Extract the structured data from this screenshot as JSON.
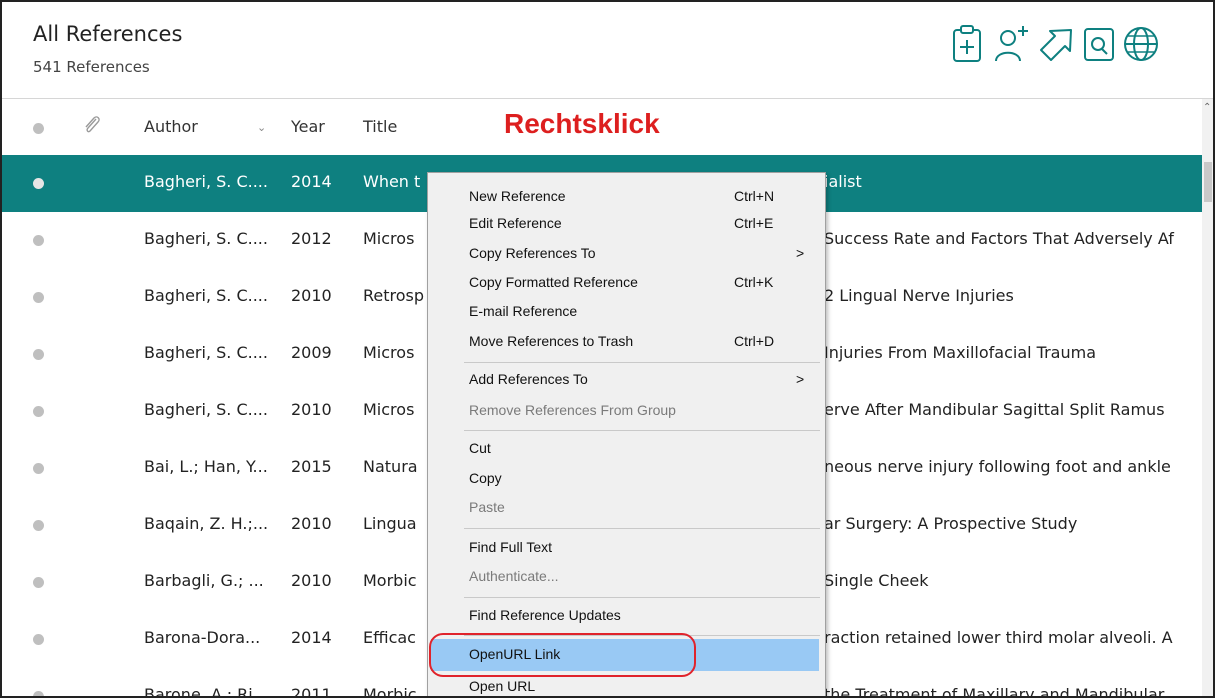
{
  "header": {
    "title": "All References",
    "count": "541 References",
    "toolbar_icons": [
      "new-reference-clipboard-icon",
      "add-user-icon",
      "open-external-arrow-icon",
      "find-text-icon",
      "online-globe-icon"
    ],
    "accent_color": "#0e8080"
  },
  "columns": {
    "author": "Author",
    "year": "Year",
    "title": "Title"
  },
  "annotation": "Rechtsklick",
  "rows": [
    {
      "author": "Bagheri, S. C....",
      "year": "2014",
      "title_start": "When t",
      "title_end": "ialist"
    },
    {
      "author": "Bagheri, S. C....",
      "year": "2012",
      "title_start": "Micros",
      "title_end": "Success Rate and Factors That Adversely Af"
    },
    {
      "author": "Bagheri, S. C....",
      "year": "2010",
      "title_start": "Retrosp",
      "title_end": "2 Lingual Nerve Injuries"
    },
    {
      "author": "Bagheri, S. C....",
      "year": "2009",
      "title_start": "Micros",
      "title_end": "Injuries From Maxillofacial Trauma"
    },
    {
      "author": "Bagheri, S. C....",
      "year": "2010",
      "title_start": "Micros",
      "title_end": "erve After Mandibular Sagittal Split Ramus"
    },
    {
      "author": "Bai, L.; Han, Y...",
      "year": "2015",
      "title_start": "Natura",
      "title_end": "neous nerve injury following foot and ankle"
    },
    {
      "author": "Baqain, Z. H.;...",
      "year": "2010",
      "title_start": "Lingua",
      "title_end": "ar Surgery: A Prospective Study"
    },
    {
      "author": "Barbagli, G.; ...",
      "year": "2010",
      "title_start": "Morbic",
      "title_end": "Single Cheek"
    },
    {
      "author": "Barona-Dora...",
      "year": "2014",
      "title_start": "Efficac",
      "title_end": "raction retained lower third molar alveoli. A"
    },
    {
      "author": "Barone, A.; Ri...",
      "year": "2011",
      "title_start": "Morbic",
      "title_end": "the Treatment of Maxillary and Mandibular"
    }
  ],
  "menu": {
    "new_reference": "New Reference",
    "new_reference_sc": "Ctrl+N",
    "edit_reference": "Edit Reference",
    "edit_reference_sc": "Ctrl+E",
    "copy_references_to": "Copy References To",
    "submenu_arrow": ">",
    "copy_formatted": "Copy Formatted Reference",
    "copy_formatted_sc": "Ctrl+K",
    "email_reference": "E-mail Reference",
    "move_to_trash": "Move References to Trash",
    "move_to_trash_sc": "Ctrl+D",
    "add_references_to": "Add References To",
    "remove_from_group": "Remove References From Group",
    "cut": "Cut",
    "copy": "Copy",
    "paste": "Paste",
    "find_full_text": "Find Full Text",
    "authenticate": "Authenticate...",
    "find_updates": "Find Reference Updates",
    "openurl_link": "OpenURL Link",
    "open_url": "Open URL"
  }
}
